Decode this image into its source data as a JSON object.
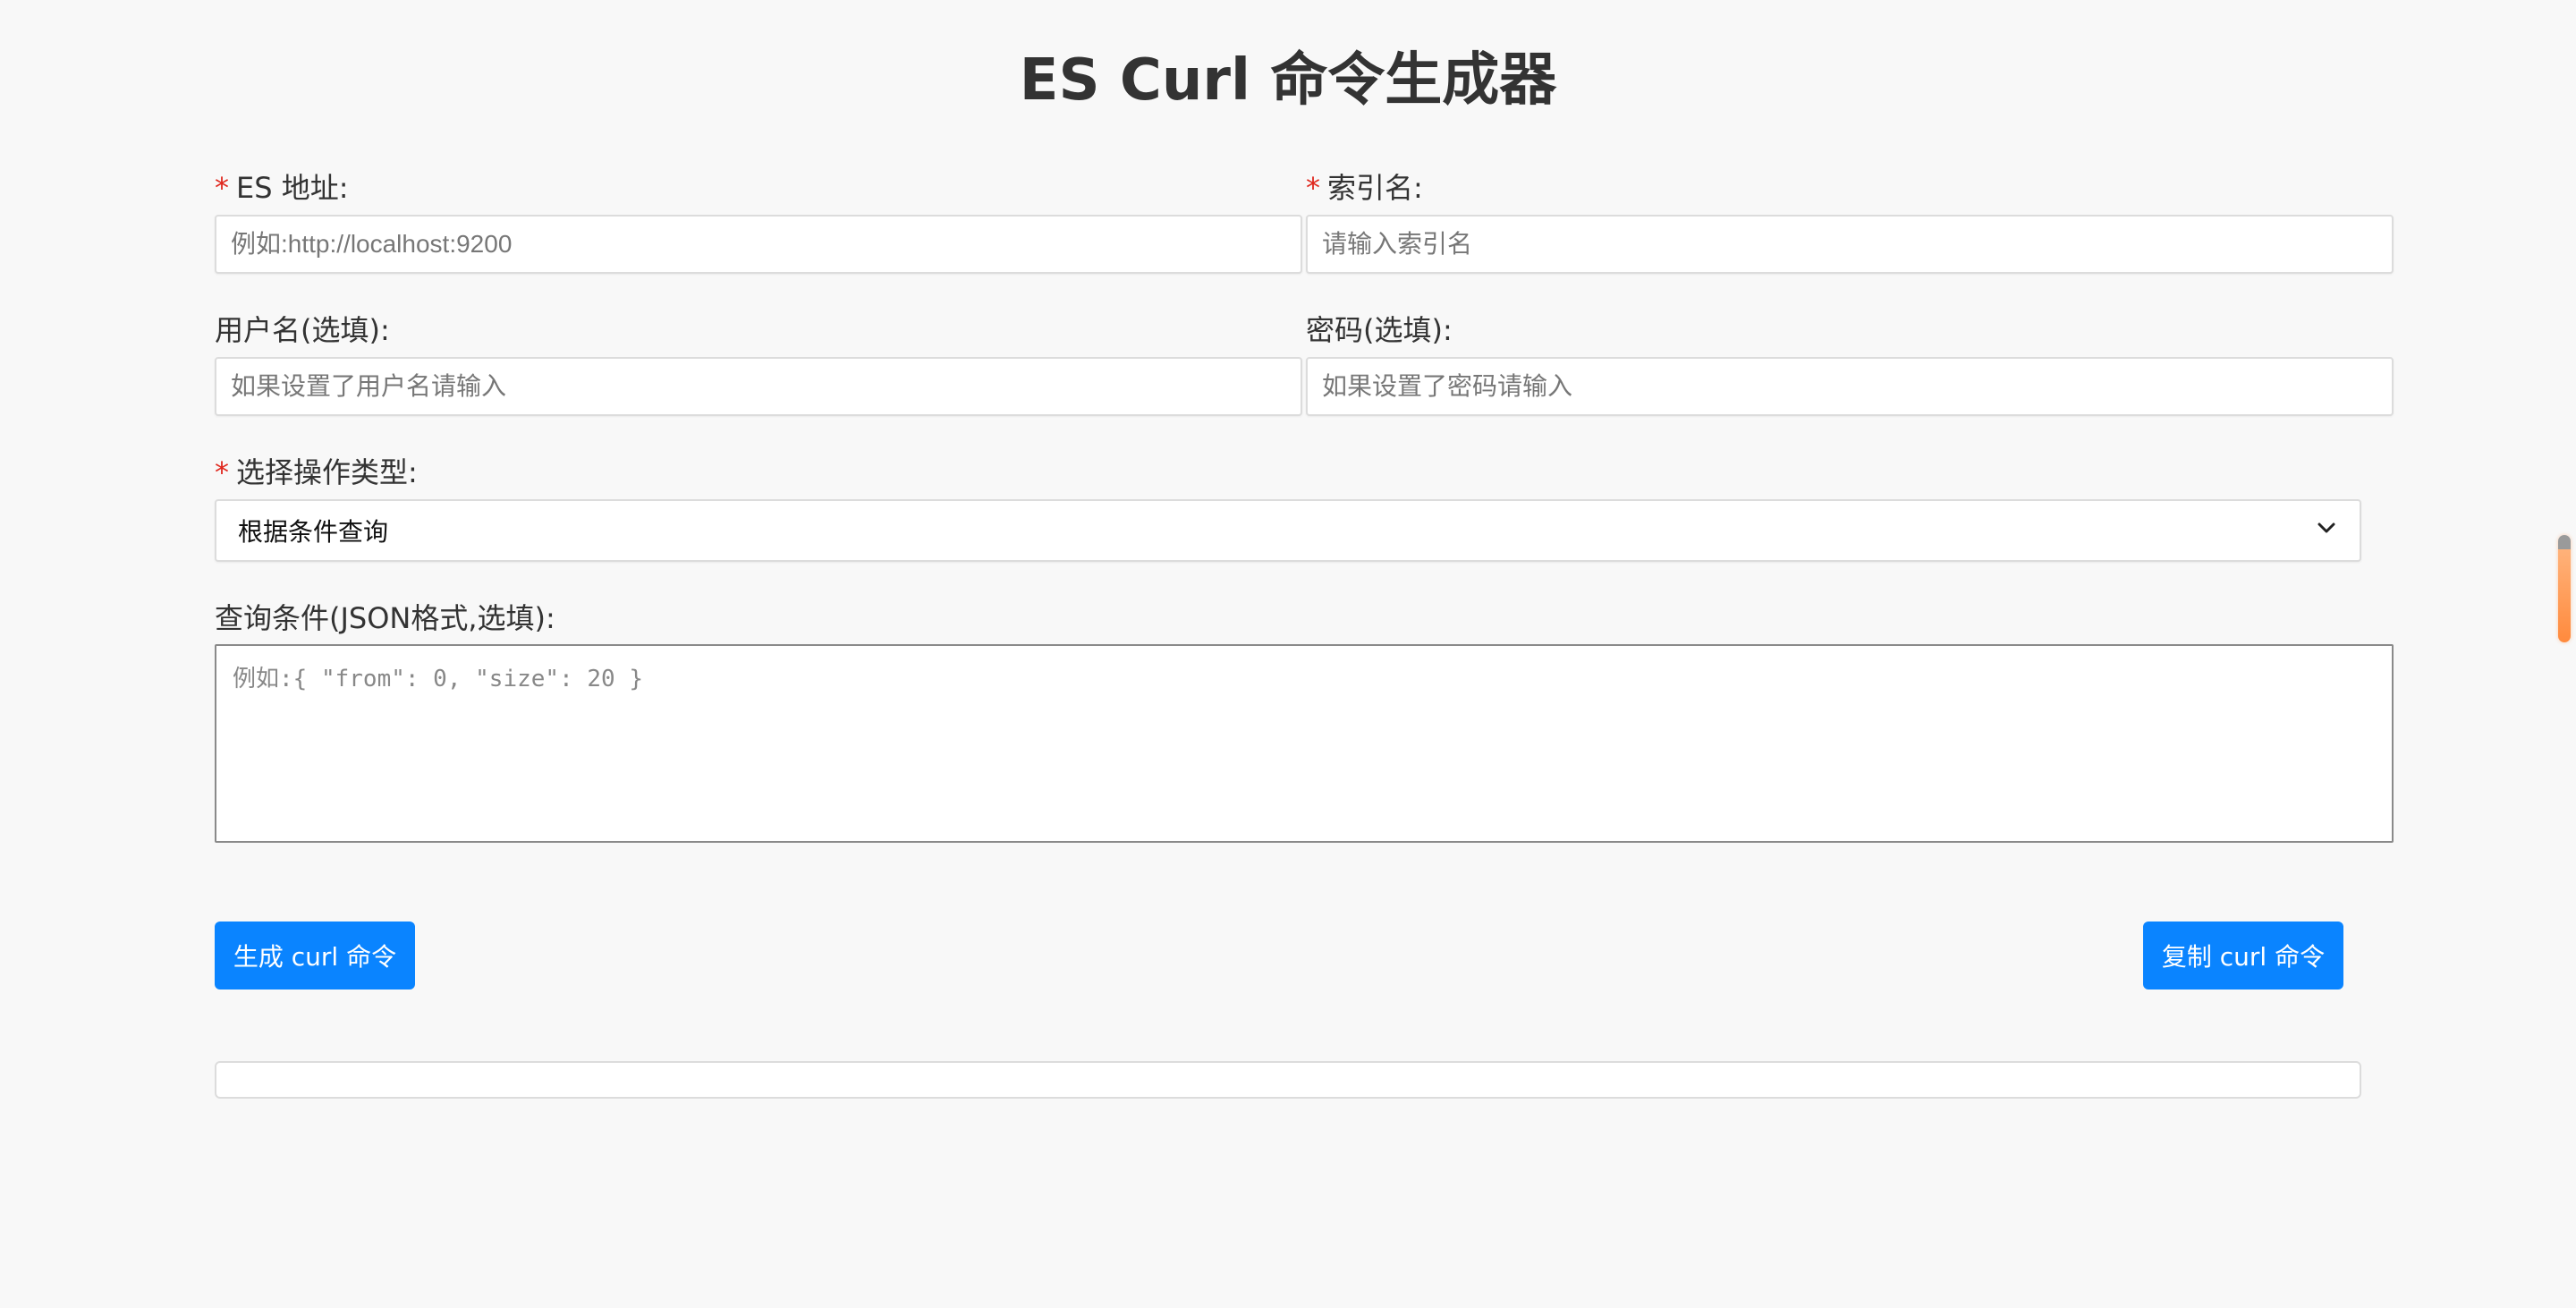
{
  "page": {
    "title": "ES Curl 命令生成器"
  },
  "form": {
    "required_mark": "*",
    "es_address": {
      "label": "ES 地址:",
      "placeholder": "例如:http://localhost:9200",
      "value": ""
    },
    "index_name": {
      "label": "索引名:",
      "placeholder": "请输入索引名",
      "value": ""
    },
    "username": {
      "label": "用户名(选填):",
      "placeholder": "如果设置了用户名请输入",
      "value": ""
    },
    "password": {
      "label": "密码(选填):",
      "placeholder": "如果设置了密码请输入",
      "value": ""
    },
    "operation": {
      "label": "选择操作类型:",
      "selected": "根据条件查询"
    },
    "query": {
      "label": "查询条件(JSON格式,选填):",
      "placeholder": "例如:{ \"from\": 0, \"size\": 20 }",
      "value": ""
    }
  },
  "actions": {
    "generate_label": "生成 curl 命令",
    "copy_label": "复制 curl 命令"
  },
  "output": {
    "text": ""
  },
  "colors": {
    "primary_button": "#0a84ff",
    "required_mark": "#e0271d",
    "background": "#f8f8f8"
  },
  "icons": {
    "select_arrow": "chevron-down-icon"
  }
}
